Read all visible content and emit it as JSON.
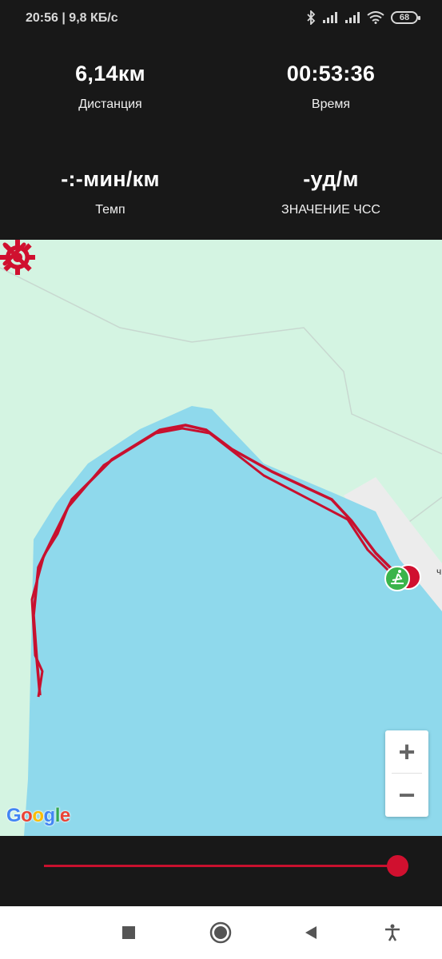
{
  "status_bar": {
    "time_speed": "20:56 | 9,8 КБ/с",
    "battery": "68",
    "icons": [
      "bluetooth-icon",
      "signal-icon",
      "signal-icon",
      "wifi-icon",
      "battery-icon"
    ]
  },
  "stats": {
    "distance": {
      "value": "6,14км",
      "label": "Дистанция"
    },
    "time": {
      "value": "00:53:36",
      "label": "Время"
    },
    "pace": {
      "value": "-:-мин/км",
      "label": "Темп"
    },
    "heart_rate": {
      "value": "-уд/м",
      "label": "ЗНАЧЕНИЕ ЧСС"
    }
  },
  "map": {
    "attribution": "Google",
    "street_label_fragment": "ч",
    "zoom_in_label": "+",
    "zoom_out_label": "−",
    "icons": {
      "settings": "gear-icon",
      "close": "close-icon",
      "start_marker": "rowing-icon",
      "end_marker": "finish-marker-icon"
    }
  },
  "colors": {
    "accent": "#d0102f",
    "background": "#181818",
    "water": "#8fd9ec",
    "land": "#d4f4e2",
    "route": "#c8102e",
    "start_marker": "#3bb44a"
  },
  "slider": {
    "progress": 1.0
  },
  "nav": {
    "icons": [
      "square-icon",
      "home-circle-icon",
      "back-triangle-icon",
      "accessibility-icon"
    ]
  }
}
